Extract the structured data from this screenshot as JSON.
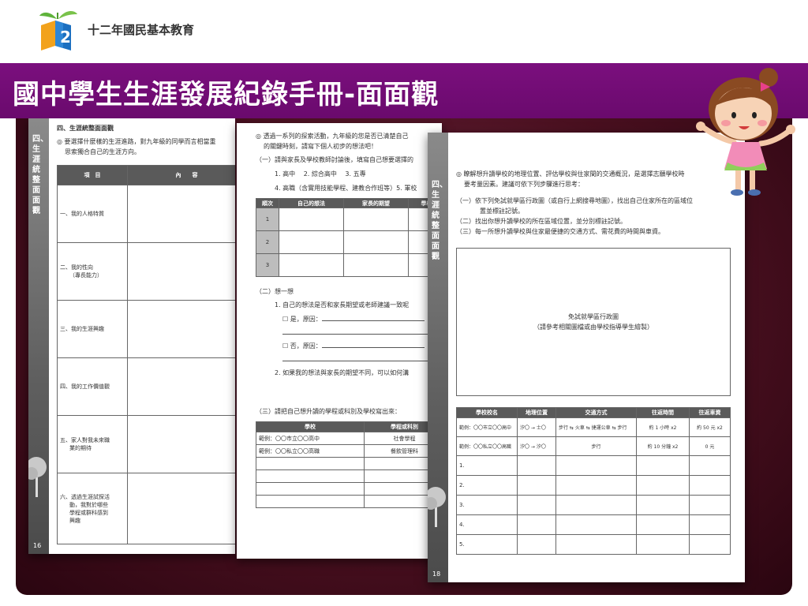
{
  "header": {
    "brand": "十二年國民基本教育"
  },
  "title": "國中學生生涯發展紀錄手冊-面面觀",
  "page1": {
    "side": "四、生涯統整面面觀",
    "heading": "四、生涯統整面面觀",
    "intro1": "◎ 要選擇什麼樣的生涯進路，對九年級的同學而言相當重",
    "intro2": "思索獨合自己的生涯方向。",
    "col_item": "項　目",
    "col_content": "內　　容",
    "rows": [
      "一、我的人格特質",
      "二、我的性向",
      "（專長能力）",
      "三、我的生涯興趣",
      "四、我的工作價值觀",
      "五、家人對我未來職",
      "業的期待",
      "六、透過生涯試探活",
      "動，我對於哪些",
      "學程或群科感到",
      "興趣"
    ],
    "page_no": "16"
  },
  "page2": {
    "intro1": "◎ 透過一系列的探索活動，九年級的您是否已清楚自己",
    "intro2": "的關鍵時刻，請寫下個人初步的想法吧！",
    "q1": "（一）請與家長及學校教師討論後，填寫自己想要選擇的",
    "opt1": "1. 高中　 2. 綜合高中　 3. 五專",
    "opt2": "4. 高職（含實用技能學程、建教合作班等）5. 軍校",
    "t1_headers": [
      "順次",
      "自己的想法",
      "家長的期望",
      "學校"
    ],
    "t1_rows": [
      "1",
      "2",
      "3"
    ],
    "q2": "（二）想一想",
    "q2_1": "1. 自己的想法是否和家長期望或老師建議一致呢",
    "yes": "☐ 是，原因：",
    "no": "☐ 否，原因：",
    "q2_2": "2. 如果我的想法與家長的期望不同，可以如何溝",
    "q3": "（三）請把自己想升讀的學程或科別及學校寫出來：",
    "t2_headers": [
      "學校",
      "學程或科別"
    ],
    "t2_rows": [
      [
        "範例：〇〇市立〇〇高中",
        "社會學程"
      ],
      [
        "範例：〇〇私立〇〇高職",
        "餐飲管理科"
      ]
    ]
  },
  "page3": {
    "side": "四、生涯統整面面觀",
    "intro1": "◎ 瞭解想升讀學校的地理位置、評估學校與住家間的交通概況，是選擇志願學校時",
    "intro2": "要考量因素。建議可依下列步驟進行思考：",
    "s1a": "（一）依下列免試就學區行政圖（或自行上網搜尋地圖），找出自己住家所在的區域位",
    "s1b": "置並標註記號。",
    "s2": "（二）找出你想升讀學校的所在區域位置，並分別標註記號。",
    "s3": "（三）每一所想升讀學校與住家最便捷的交通方式、需花費的時間與車資。",
    "map1": "免試就學區行政圖",
    "map2": "（請參考相關圖檔或由學校指導學生繪製）",
    "headers": [
      "學校校名",
      "地理位置",
      "交通方式",
      "往返時間",
      "往返車資"
    ],
    "ex1": [
      "範例：〇〇市立〇〇高中",
      "汐〇 → 士〇",
      "步行 ⇆ 火車 ⇆ 捷運公車 ⇆ 步行",
      "約 1 小時 x2",
      "約 50 元 x2"
    ],
    "ex2": [
      "範例：〇〇私立〇〇高職",
      "汐〇 → 汐〇",
      "步行",
      "約 10 分鐘 x2",
      "0 元"
    ],
    "rows": [
      "1.",
      "2.",
      "3.",
      "4.",
      "5."
    ],
    "page_no": "18"
  }
}
